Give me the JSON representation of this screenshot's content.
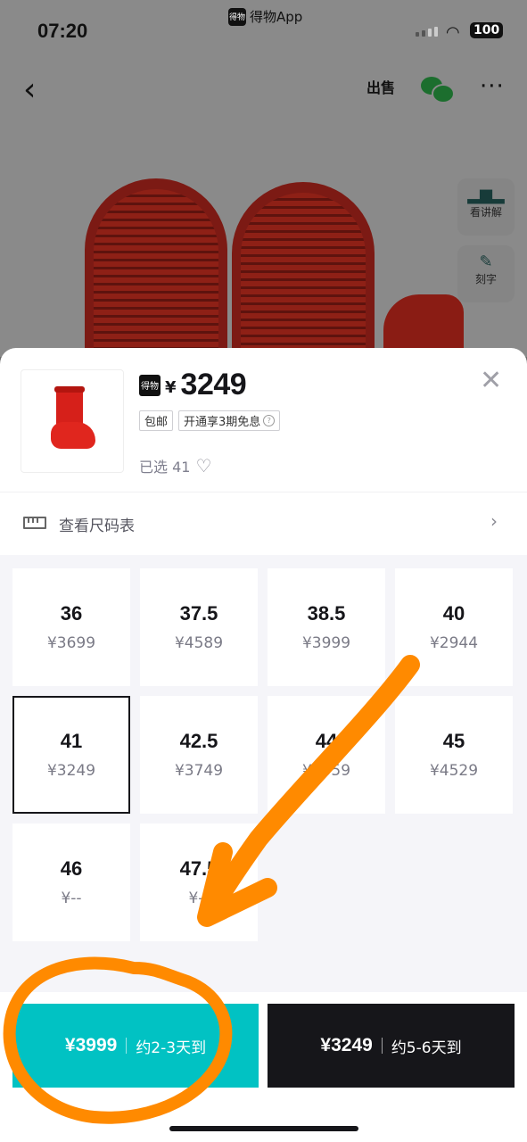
{
  "status_bar": {
    "time": "07:20",
    "app_name": "得物App",
    "battery": "100"
  },
  "header": {
    "sell_label": "出售",
    "more_label": "···"
  },
  "side_actions": [
    {
      "label": "看讲解",
      "icon": "bar-chart-icon"
    },
    {
      "label": "刻字",
      "icon": "pen-icon"
    }
  ],
  "sheet": {
    "logo_text": "得物",
    "currency": "¥",
    "price": "3249",
    "tags": [
      "包邮",
      "开通享3期免息"
    ],
    "selected_text": "已选 41",
    "size_chart_label": "查看尺码表"
  },
  "sizes": [
    {
      "size": "36",
      "price": "¥3699"
    },
    {
      "size": "37.5",
      "price": "¥4589"
    },
    {
      "size": "38.5",
      "price": "¥3999"
    },
    {
      "size": "40",
      "price": "¥2944"
    },
    {
      "size": "41",
      "price": "¥3249",
      "selected": true
    },
    {
      "size": "42.5",
      "price": "¥3749"
    },
    {
      "size": "44",
      "price": "¥5059"
    },
    {
      "size": "45",
      "price": "¥4529"
    },
    {
      "size": "46",
      "price": "¥--"
    },
    {
      "size": "47.5",
      "price": "¥--"
    }
  ],
  "buttons": {
    "fast": {
      "price": "¥3999",
      "eta": "约2-3天到"
    },
    "normal": {
      "price": "¥3249",
      "eta": "约5-6天到"
    }
  },
  "colors": {
    "fast_button": "#01c2c3",
    "normal_button": "#16161a",
    "annotation": "#ff8a00"
  }
}
